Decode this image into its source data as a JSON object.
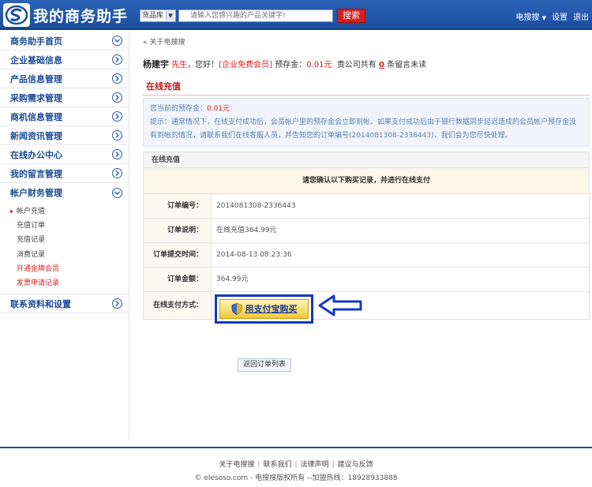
{
  "header": {
    "logo_text": "我的商务助手",
    "search_category": "货品库",
    "search_placeholder": "请输入您感兴趣的产品关键字!",
    "search_button": "搜索",
    "top_links": [
      "电搜搜",
      "设置",
      "退出"
    ]
  },
  "sidebar": {
    "items_top": [
      {
        "label": "商务助手首页"
      },
      {
        "label": "企业基础信息"
      },
      {
        "label": "产品信息管理"
      },
      {
        "label": "采购需求管理"
      },
      {
        "label": "商机信息管理"
      },
      {
        "label": "新闻资讯管理"
      },
      {
        "label": "在线办公中心"
      },
      {
        "label": "我的留言管理"
      },
      {
        "label": "帐户财务管理"
      }
    ],
    "subitems": [
      {
        "label": "帐户充值",
        "active": true
      },
      {
        "label": "充值订单"
      },
      {
        "label": "充值记录"
      },
      {
        "label": "消费记录"
      },
      {
        "label": "开通金牌会员",
        "red": true
      },
      {
        "label": "发票申请记录",
        "red": true
      }
    ],
    "items_bottom": [
      {
        "label": "联系资料和设置"
      }
    ]
  },
  "main": {
    "breadcrumb": "« 关于电搜搜",
    "user": {
      "name": "杨建宇",
      "title": "先生",
      "greeting": "，您好！",
      "member": "[企业免费会员]",
      "balance_label": "预存金：",
      "balance": "0.01元",
      "msg_prefix": "贵公司共有",
      "msg_count": "0",
      "msg_suffix": "条留言未读"
    },
    "section_title": "在线充值",
    "info": {
      "balance_label": "您当前的预存金：",
      "balance": "0.01元",
      "tip": "提示：通常情况下，在线支付成功后，会员帐户里的预存金会立即到帐。如果支付成功后由于银行数据同步延迟造成的会员帐户预存金没有到帐的情况，请联系我们在线客服人员，并告知您的订单编号(2014081308-2336443)，我们会为您尽快处理。"
    },
    "order": {
      "head": "在线充值",
      "confirm": "请您确认以下购买记录，并进行在线支付",
      "rows": [
        {
          "k": "订单编号：",
          "v": "2014081308-2336443"
        },
        {
          "k": "订单说明：",
          "v": "在线充值364.99元"
        },
        {
          "k": "订单提交时间：",
          "v": "2014-08-13 08:23:36"
        },
        {
          "k": "订单金额：",
          "v": "364.99元"
        }
      ],
      "pay_label": "在线支付方式：",
      "pay_button": "用支付宝购买"
    },
    "back_button": "返回订单列表"
  },
  "footer": {
    "links": [
      "关于电搜搜",
      "联系我们",
      "法律声明",
      "建议与反馈"
    ],
    "copyright": "© elesoso.com - 电搜搜版权所有 --加盟热线：18928933888"
  }
}
